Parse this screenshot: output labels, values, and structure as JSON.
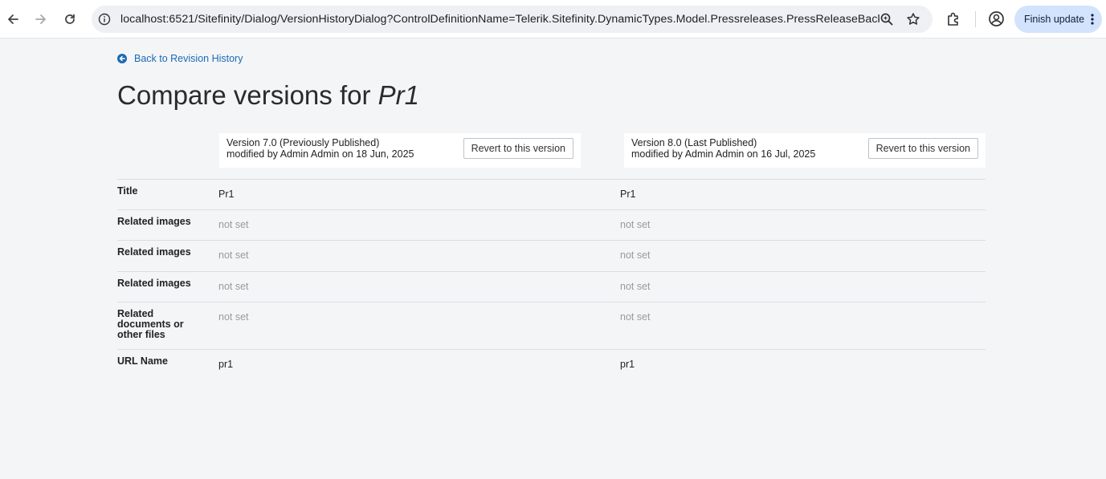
{
  "browser": {
    "url": "localhost:6521/Sitefinity/Dialog/VersionHistoryDialog?ControlDefinitionName=Telerik.Sitefinity.DynamicTypes.Model.Pressreleases.PressReleaseBacke...",
    "finish_update_label": "Finish update"
  },
  "page": {
    "back_link": "Back to Revision History",
    "title_prefix": "Compare versions for",
    "title_item": "Pr1"
  },
  "versions": [
    {
      "title": "Version 7.0 (Previously Published)",
      "meta": "modified by Admin Admin on 18 Jun, 2025",
      "revert_label": "Revert to this version"
    },
    {
      "title": "Version 8.0 (Last Published)",
      "meta": "modified by Admin Admin on 16 Jul, 2025",
      "revert_label": "Revert to this version"
    }
  ],
  "fields": [
    {
      "label": "Title",
      "v1": "Pr1",
      "v2": "Pr1"
    },
    {
      "label": "Related images",
      "v1": "not set",
      "v2": "not set"
    },
    {
      "label": "Related images",
      "v1": "not set",
      "v2": "not set"
    },
    {
      "label": "Related images",
      "v1": "not set",
      "v2": "not set"
    },
    {
      "label": "Related documents or other files",
      "v1": "not set",
      "v2": "not set"
    },
    {
      "label": "URL Name",
      "v1": "pr1",
      "v2": "pr1"
    }
  ],
  "icons": {
    "back": "arrow-left-icon",
    "forward": "arrow-right-icon",
    "reload": "reload-icon",
    "site_info": "info-icon",
    "zoom": "magnifier-icon",
    "bookmark": "star-icon",
    "extensions": "puzzle-icon",
    "profile": "profile-icon",
    "menu": "kebab-menu-icon",
    "back_link": "circle-arrow-left-icon"
  },
  "colors": {
    "page_bg": "#f4f5f7",
    "link": "#1a6ab6",
    "finish_update_bg": "#d3e3fd",
    "empty_value": "#9a9a9a"
  }
}
